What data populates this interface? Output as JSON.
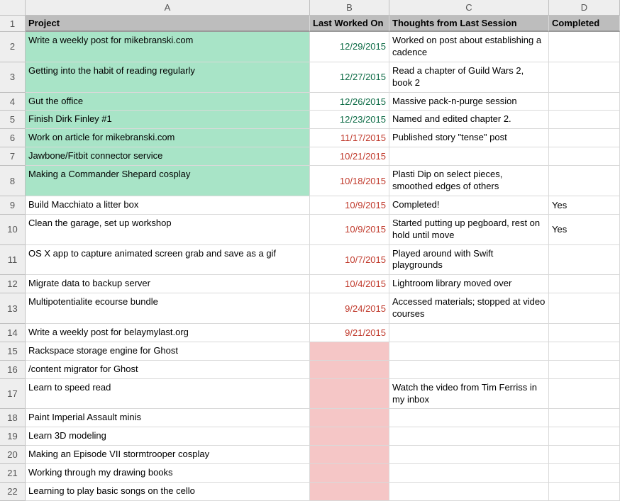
{
  "columns": [
    "A",
    "B",
    "C",
    "D"
  ],
  "headers": {
    "A": "Project",
    "B": "Last Worked On",
    "C": "Thoughts from Last Session",
    "D": "Completed"
  },
  "rows": [
    {
      "n": 2,
      "tall": true,
      "hlA": true,
      "hlB": false,
      "A": "Write a weekly post for mikebranski.com",
      "B": "12/29/2015",
      "dateCls": "date-green",
      "C": "Worked on post about establishing a cadence",
      "D": ""
    },
    {
      "n": 3,
      "tall": true,
      "hlA": true,
      "hlB": false,
      "A": "Getting into the habit of reading regularly",
      "B": "12/27/2015",
      "dateCls": "date-green",
      "C": "Read a chapter of Guild Wars 2, book 2",
      "D": ""
    },
    {
      "n": 4,
      "tall": false,
      "hlA": true,
      "hlB": false,
      "A": "Gut the office",
      "B": "12/26/2015",
      "dateCls": "date-green",
      "C": "Massive pack-n-purge session",
      "D": ""
    },
    {
      "n": 5,
      "tall": false,
      "hlA": true,
      "hlB": false,
      "A": "Finish Dirk Finley #1",
      "B": "12/23/2015",
      "dateCls": "date-green",
      "C": "Named and edited chapter 2.",
      "D": ""
    },
    {
      "n": 6,
      "tall": false,
      "hlA": true,
      "hlB": false,
      "A": "Work on article for mikebranski.com",
      "B": "11/17/2015",
      "dateCls": "date-red",
      "C": "Published story \"tense\" post",
      "D": ""
    },
    {
      "n": 7,
      "tall": false,
      "hlA": true,
      "hlB": false,
      "A": "Jawbone/Fitbit connector service",
      "B": "10/21/2015",
      "dateCls": "date-red",
      "C": "",
      "D": ""
    },
    {
      "n": 8,
      "tall": true,
      "hlA": true,
      "hlB": false,
      "A": "Making a Commander Shepard cosplay",
      "B": "10/18/2015",
      "dateCls": "date-red",
      "C": "Plasti Dip on select pieces, smoothed edges of others",
      "D": ""
    },
    {
      "n": 9,
      "tall": false,
      "hlA": false,
      "hlB": false,
      "A": "Build Macchiato a litter box",
      "B": "10/9/2015",
      "dateCls": "date-red",
      "C": "Completed!",
      "D": "Yes"
    },
    {
      "n": 10,
      "tall": true,
      "hlA": false,
      "hlB": false,
      "A": "Clean the garage, set up workshop",
      "B": "10/9/2015",
      "dateCls": "date-red",
      "C": "Started putting up pegboard, rest on hold until move",
      "D": "Yes"
    },
    {
      "n": 11,
      "tall": true,
      "hlA": false,
      "hlB": false,
      "A": "OS X app to capture animated screen grab and save as a gif",
      "B": "10/7/2015",
      "dateCls": "date-red",
      "C": "Played around with Swift playgrounds",
      "D": ""
    },
    {
      "n": 12,
      "tall": false,
      "hlA": false,
      "hlB": false,
      "A": "Migrate data to backup server",
      "B": "10/4/2015",
      "dateCls": "date-red",
      "C": "Lightroom library moved over",
      "D": ""
    },
    {
      "n": 13,
      "tall": true,
      "hlA": false,
      "hlB": false,
      "A": "Multipotentialite ecourse bundle",
      "B": "9/24/2015",
      "dateCls": "date-red",
      "C": "Accessed materials; stopped at video courses",
      "D": ""
    },
    {
      "n": 14,
      "tall": false,
      "hlA": false,
      "hlB": false,
      "A": "Write a weekly post for belaymylast.org",
      "B": "9/21/2015",
      "dateCls": "date-red",
      "C": "",
      "D": ""
    },
    {
      "n": 15,
      "tall": false,
      "hlA": false,
      "hlB": true,
      "A": "Rackspace storage engine for Ghost",
      "B": "",
      "dateCls": "",
      "C": "",
      "D": ""
    },
    {
      "n": 16,
      "tall": false,
      "hlA": false,
      "hlB": true,
      "A": "/content migrator for Ghost",
      "B": "",
      "dateCls": "",
      "C": "",
      "D": ""
    },
    {
      "n": 17,
      "tall": true,
      "hlA": false,
      "hlB": true,
      "A": "Learn to speed read",
      "B": "",
      "dateCls": "",
      "C": "Watch the video from Tim Ferriss in my inbox",
      "D": ""
    },
    {
      "n": 18,
      "tall": false,
      "hlA": false,
      "hlB": true,
      "A": "Paint Imperial Assault minis",
      "B": "",
      "dateCls": "",
      "C": "",
      "D": ""
    },
    {
      "n": 19,
      "tall": false,
      "hlA": false,
      "hlB": true,
      "A": "Learn 3D modeling",
      "B": "",
      "dateCls": "",
      "C": "",
      "D": ""
    },
    {
      "n": 20,
      "tall": false,
      "hlA": false,
      "hlB": true,
      "A": "Making an Episode VII stormtrooper cosplay",
      "B": "",
      "dateCls": "",
      "C": "",
      "D": ""
    },
    {
      "n": 21,
      "tall": false,
      "hlA": false,
      "hlB": true,
      "A": "Working through my drawing books",
      "B": "",
      "dateCls": "",
      "C": "",
      "D": ""
    },
    {
      "n": 22,
      "tall": false,
      "hlA": false,
      "hlB": true,
      "A": "Learning to play basic songs on the cello",
      "B": "",
      "dateCls": "",
      "C": "",
      "D": ""
    }
  ]
}
